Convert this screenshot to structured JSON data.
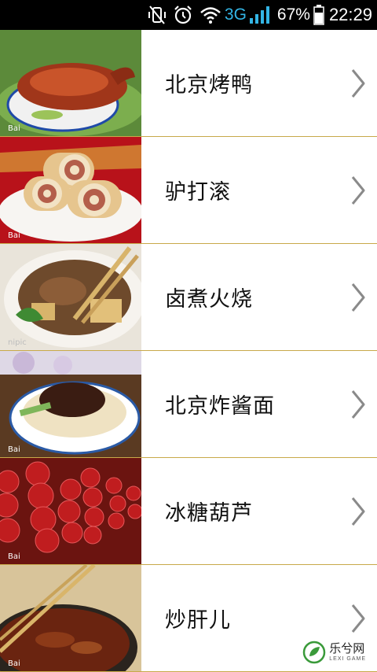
{
  "status_bar": {
    "network": "3G",
    "battery": "67%",
    "time": "22:29"
  },
  "items": [
    {
      "label": "北京烤鸭",
      "icon": "roast-duck-image"
    },
    {
      "label": "驴打滚",
      "icon": "rolled-pastry-image"
    },
    {
      "label": "卤煮火烧",
      "icon": "braised-stew-image"
    },
    {
      "label": "北京炸酱面",
      "icon": "noodles-image"
    },
    {
      "label": "冰糖葫芦",
      "icon": "candied-haws-image"
    },
    {
      "label": "炒肝儿",
      "icon": "liver-stew-image"
    }
  ],
  "watermark": {
    "name": "乐兮网",
    "subtitle": "LEXI GAME"
  },
  "colors": {
    "separator": "#c8a94a",
    "status_bg": "#000000",
    "network_accent": "#33b5e5"
  }
}
